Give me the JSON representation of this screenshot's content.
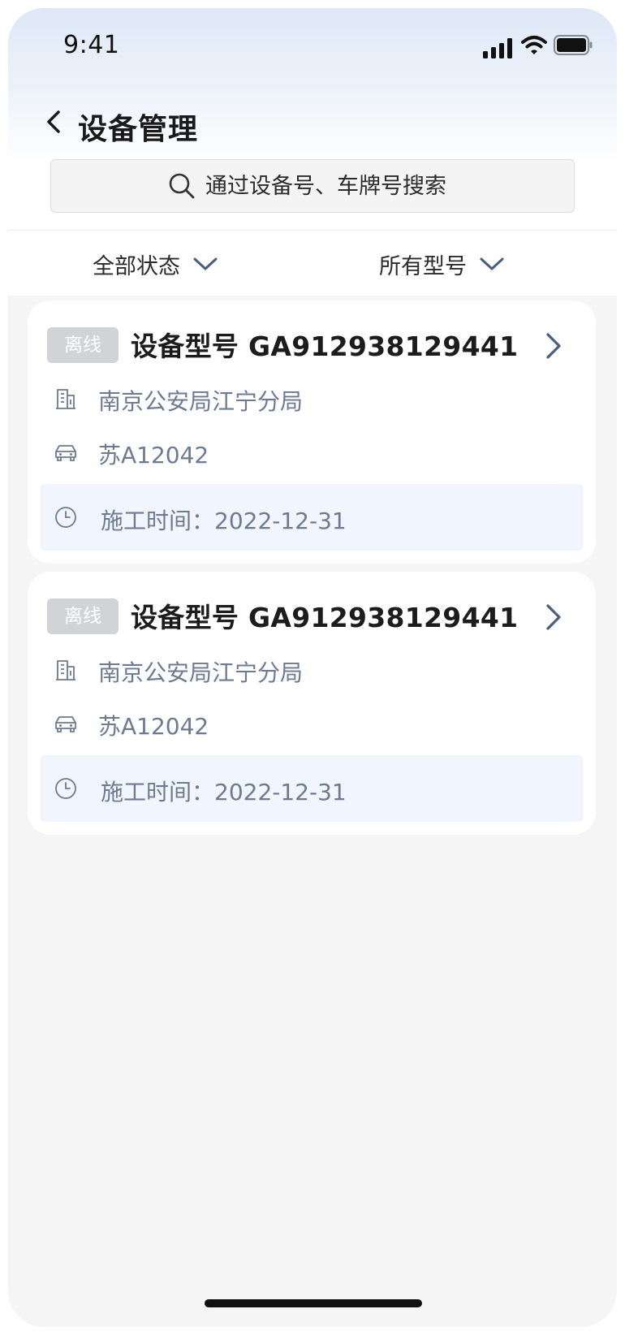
{
  "status_bar": {
    "time": "9:41"
  },
  "header": {
    "title": "设备管理"
  },
  "search": {
    "placeholder": "通过设备号、车牌号搜索"
  },
  "filters": [
    {
      "label": "全部状态"
    },
    {
      "label": "所有型号"
    }
  ],
  "devices": [
    {
      "status": "离线",
      "title": "设备型号 GA912938129441",
      "organization": "南京公安局江宁分局",
      "plate": "苏A12042",
      "construction_time": "施工时间：2022-12-31"
    },
    {
      "status": "离线",
      "title": "设备型号 GA912938129441",
      "organization": "南京公安局江宁分局",
      "plate": "苏A12042",
      "construction_time": "施工时间：2022-12-31"
    }
  ],
  "colors": {
    "accent_text": "#6c7a92",
    "badge_bg": "#d2d3d6",
    "time_box_bg": "#f0f5fe",
    "page_bg": "#f5f5f6"
  },
  "icons": {
    "back": "chevron-left-icon",
    "search": "search-icon",
    "dropdown": "chevron-down-icon",
    "organization": "building-icon",
    "plate": "car-icon",
    "time": "clock-icon",
    "detail": "chevron-right-icon"
  }
}
